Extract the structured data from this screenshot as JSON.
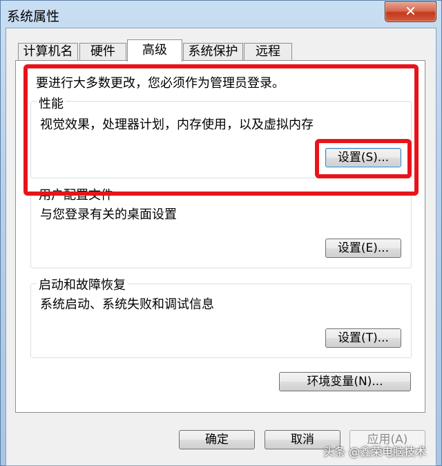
{
  "window": {
    "title": "系统属性",
    "close_label": "✕"
  },
  "tabs": [
    {
      "label": "计算机名",
      "active": false
    },
    {
      "label": "硬件",
      "active": false
    },
    {
      "label": "高级",
      "active": true
    },
    {
      "label": "系统保护",
      "active": false
    },
    {
      "label": "远程",
      "active": false
    }
  ],
  "admin_notice": "要进行大多数更改，您必须作为管理员登录。",
  "performance": {
    "title": "性能",
    "description": "视觉效果，处理器计划，内存使用，以及虚拟内存",
    "button_label": "设置(S)..."
  },
  "user_profiles": {
    "title": "用户配置文件",
    "description": "与您登录有关的桌面设置",
    "button_label": "设置(E)..."
  },
  "startup_recovery": {
    "title": "启动和故障恢复",
    "description": "系统启动、系统失败和调试信息",
    "button_label": "设置(T)..."
  },
  "env_button_label": "环境变量(N)...",
  "footer": {
    "ok_label": "确定",
    "cancel_label": "取消",
    "apply_label": "应用(A)"
  },
  "watermark": "头条 @鑫荣电脑技术",
  "colors": {
    "highlight": "#e8141a",
    "window_frame": "#b7d0ea",
    "close_button": "#c3391d"
  }
}
